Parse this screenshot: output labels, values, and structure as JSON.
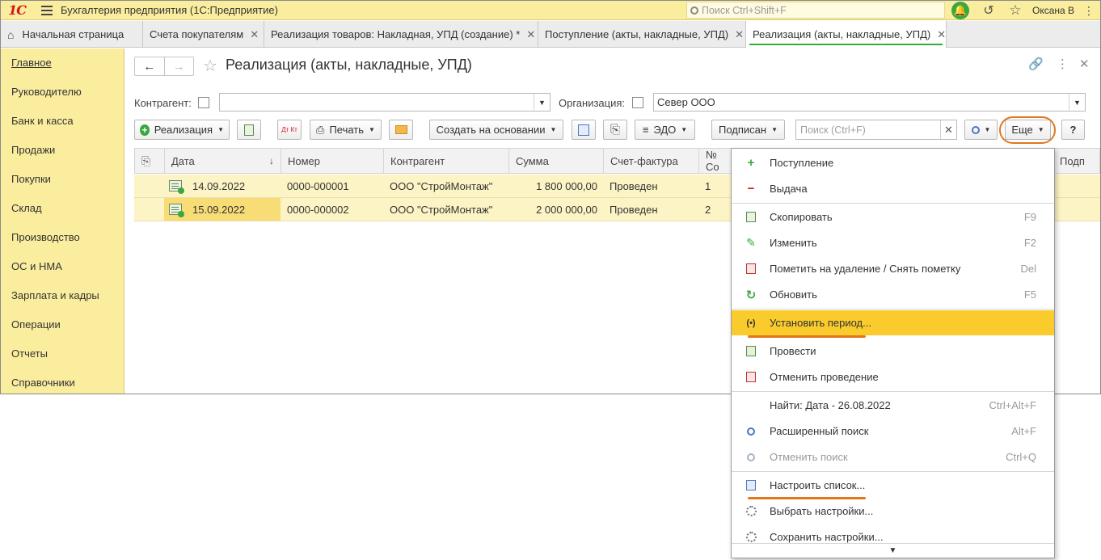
{
  "window": {
    "title": "Бухгалтерия предприятия  (1С:Предприятие)",
    "search_placeholder": "Поиск Ctrl+Shift+F",
    "user": "Оксана В"
  },
  "tabs": [
    {
      "label": "Начальная страница",
      "closable": false
    },
    {
      "label": "Счета покупателям",
      "closable": true
    },
    {
      "label": "Реализация товаров: Накладная, УПД (создание) *",
      "closable": true
    },
    {
      "label": "Поступление (акты, накладные, УПД)",
      "closable": true
    },
    {
      "label": "Реализация (акты, накладные, УПД)",
      "closable": true,
      "active": true
    }
  ],
  "sidebar": {
    "items": [
      {
        "label": "Главное"
      },
      {
        "label": "Руководителю"
      },
      {
        "label": "Банк и касса"
      },
      {
        "label": "Продажи"
      },
      {
        "label": "Покупки"
      },
      {
        "label": "Склад"
      },
      {
        "label": "Производство"
      },
      {
        "label": "ОС и НМА"
      },
      {
        "label": "Зарплата и кадры"
      },
      {
        "label": "Операции"
      },
      {
        "label": "Отчеты"
      },
      {
        "label": "Справочники"
      }
    ]
  },
  "page": {
    "title": "Реализация (акты, накладные, УПД)",
    "filters": {
      "counterparty_label": "Контрагент:",
      "counterparty_value": "",
      "org_label": "Организация:",
      "org_value": "Север ООО"
    },
    "toolbar": {
      "create_label": "Реализация",
      "dtkt_label": "Дт Кт",
      "print_label": "Печать",
      "based_on_label": "Создать на основании",
      "edo_label": "ЭДО",
      "signed_label": "Подписан",
      "search_placeholder": "Поиск (Ctrl+F)",
      "more_label": "Еще",
      "help_label": "?"
    },
    "table": {
      "columns": [
        "Дата",
        "Номер",
        "Контрагент",
        "Сумма",
        "Счет-фактура",
        "№ Со",
        "Подп"
      ],
      "rows": [
        {
          "date": "14.09.2022",
          "number": "0000-000001",
          "counterparty": "ООО \"СтройМонтаж\"",
          "sum": "1 800 000,00",
          "invoice": "Проведен",
          "n": "1"
        },
        {
          "date": "15.09.2022",
          "number": "0000-000002",
          "counterparty": "ООО \"СтройМонтаж\"",
          "sum": "2 000 000,00",
          "invoice": "Проведен",
          "n": "2"
        }
      ]
    }
  },
  "menu": {
    "items": [
      {
        "label": "Поступление",
        "shortcut": ""
      },
      {
        "label": "Выдача",
        "shortcut": ""
      },
      {
        "label": "Скопировать",
        "shortcut": "F9"
      },
      {
        "label": "Изменить",
        "shortcut": "F2"
      },
      {
        "label": "Пометить на удаление / Снять пометку",
        "shortcut": "Del"
      },
      {
        "label": "Обновить",
        "shortcut": "F5"
      },
      {
        "label": "Установить период...",
        "shortcut": ""
      },
      {
        "label": "Провести",
        "shortcut": ""
      },
      {
        "label": "Отменить проведение",
        "shortcut": ""
      },
      {
        "label": "Найти: Дата - 26.08.2022",
        "shortcut": "Ctrl+Alt+F"
      },
      {
        "label": "Расширенный поиск",
        "shortcut": "Alt+F"
      },
      {
        "label": "Отменить поиск",
        "shortcut": "Ctrl+Q"
      },
      {
        "label": "Настроить список...",
        "shortcut": ""
      },
      {
        "label": "Выбрать настройки...",
        "shortcut": ""
      },
      {
        "label": "Сохранить настройки...",
        "shortcut": ""
      }
    ]
  },
  "colors": {
    "title_bar": "#fbed9e",
    "sidebar": "#fbed9e",
    "row_bg": "#fdf4c5",
    "selected_cell": "#f8dc76",
    "menu_highlight": "#f9cb2c",
    "accent_green": "#3aa83e",
    "annotation_orange": "#e2761b"
  }
}
